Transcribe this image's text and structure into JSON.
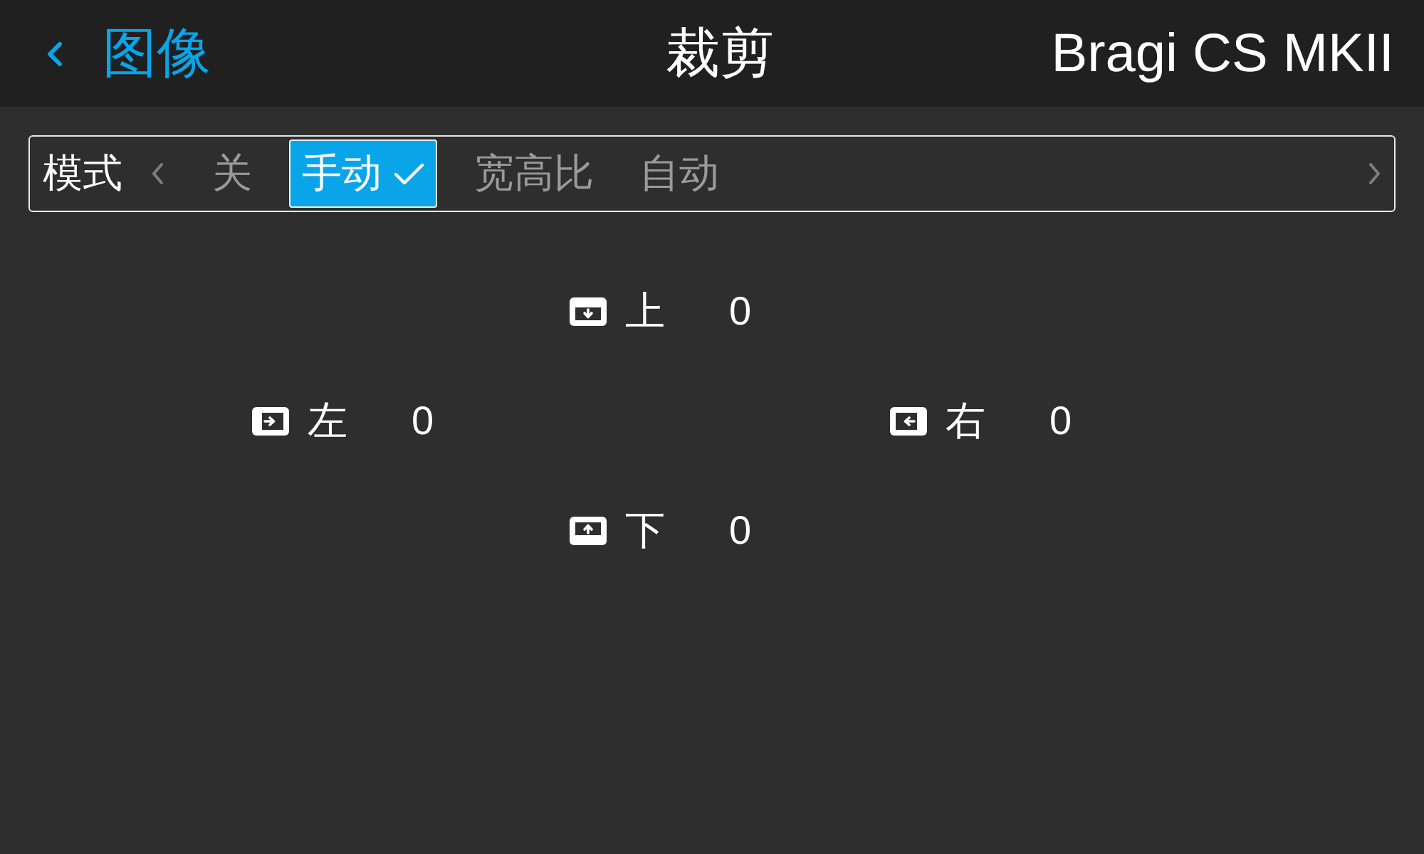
{
  "header": {
    "back_label": "图像",
    "title": "裁剪",
    "device": "Bragi CS MKII"
  },
  "mode_selector": {
    "label": "模式",
    "options": [
      {
        "label": "关",
        "selected": false
      },
      {
        "label": "手动",
        "selected": true
      },
      {
        "label": "宽高比",
        "selected": false
      },
      {
        "label": "自动",
        "selected": false
      }
    ]
  },
  "crop_edges": [
    {
      "kind": "top",
      "label": "上",
      "value": "0"
    },
    {
      "kind": "left",
      "label": "左",
      "value": "0"
    },
    {
      "kind": "right",
      "label": "右",
      "value": "0"
    },
    {
      "kind": "bottom",
      "label": "下",
      "value": "0"
    }
  ]
}
